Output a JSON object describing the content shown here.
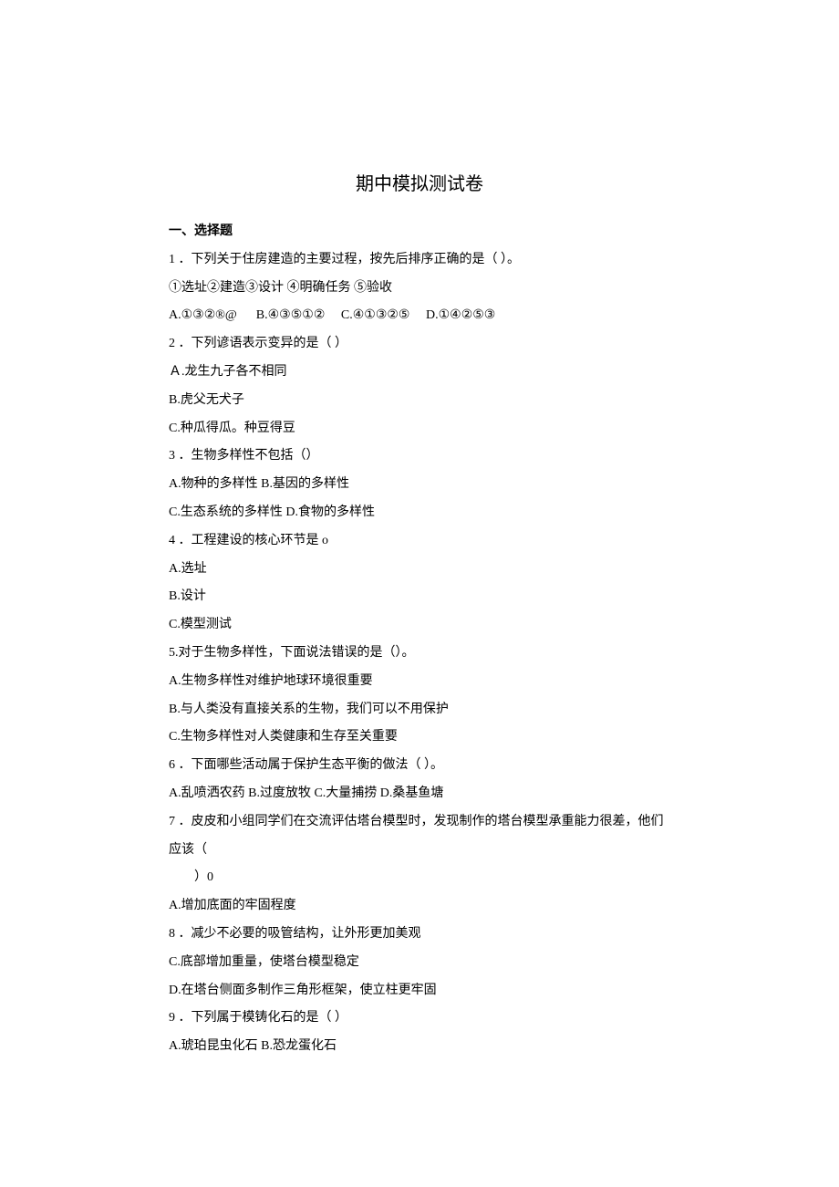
{
  "title": "期中模拟测试卷",
  "section1": {
    "heading": "一、选择题"
  },
  "q1": {
    "stem": "1 ．下列关于住房建造的主要过程，按先后排序正确的是（           ）。",
    "steps": "①选址②建造③设计            ④明确任务       ⑤验收",
    "options": "A.①③②®@      B.④③⑤①②     C.④①③②⑤     D.①④②⑤③"
  },
  "q2": {
    "stem": "2 ．下列谚语表示变异的是（     ）",
    "optA": "Ａ.龙生九子各不相同",
    "optB": "B.虎父无犬子",
    "optC": "C.种瓜得瓜。种豆得豆"
  },
  "q3": {
    "stem": "3 ．生物多样性不包括（）",
    "optAB": "A.物种的多样性 B.基因的多样性",
    "optCD": "C.生态系统的多样性 D.食物的多样性"
  },
  "q4": {
    "stem": "4 ．工程建设的核心环节是 o",
    "optA": "A.选址",
    "optB": "B.设计",
    "optC": "C.模型测试"
  },
  "q5": {
    "stem": "5.对于生物多样性，下面说法错误的是（）。",
    "optA": "A.生物多样性对维护地球环境很重要",
    "optB": "B.与人类没有直接关系的生物，我们可以不用保护",
    "optC": "C.生物多样性对人类健康和生存至关重要"
  },
  "q6": {
    "stem": "6 ．下面哪些活动属于保护生态平衡的做法（          ）。",
    "options": "A.乱喷洒农药 B.过度放牧 C.大量捕捞 D.桑基鱼塘"
  },
  "q7": {
    "stem": "7 ．皮皮和小组同学们在交流评估塔台模型时，发现制作的塔台模型承重能力很差，他们应该（",
    "stem2": "）0",
    "optA": "A.增加底面的牢固程度",
    "optB": "8 ．减少不必要的吸管结构，让外形更加美观",
    "optC": "C.底部增加重量，使塔台模型稳定",
    "optD": "D.在塔台侧面多制作三角形框架，使立柱更牢固"
  },
  "q9": {
    "stem": "9 ．下列属于模铸化石的是（     ）",
    "options": "A.琥珀昆虫化石 B.恐龙蛋化石"
  }
}
